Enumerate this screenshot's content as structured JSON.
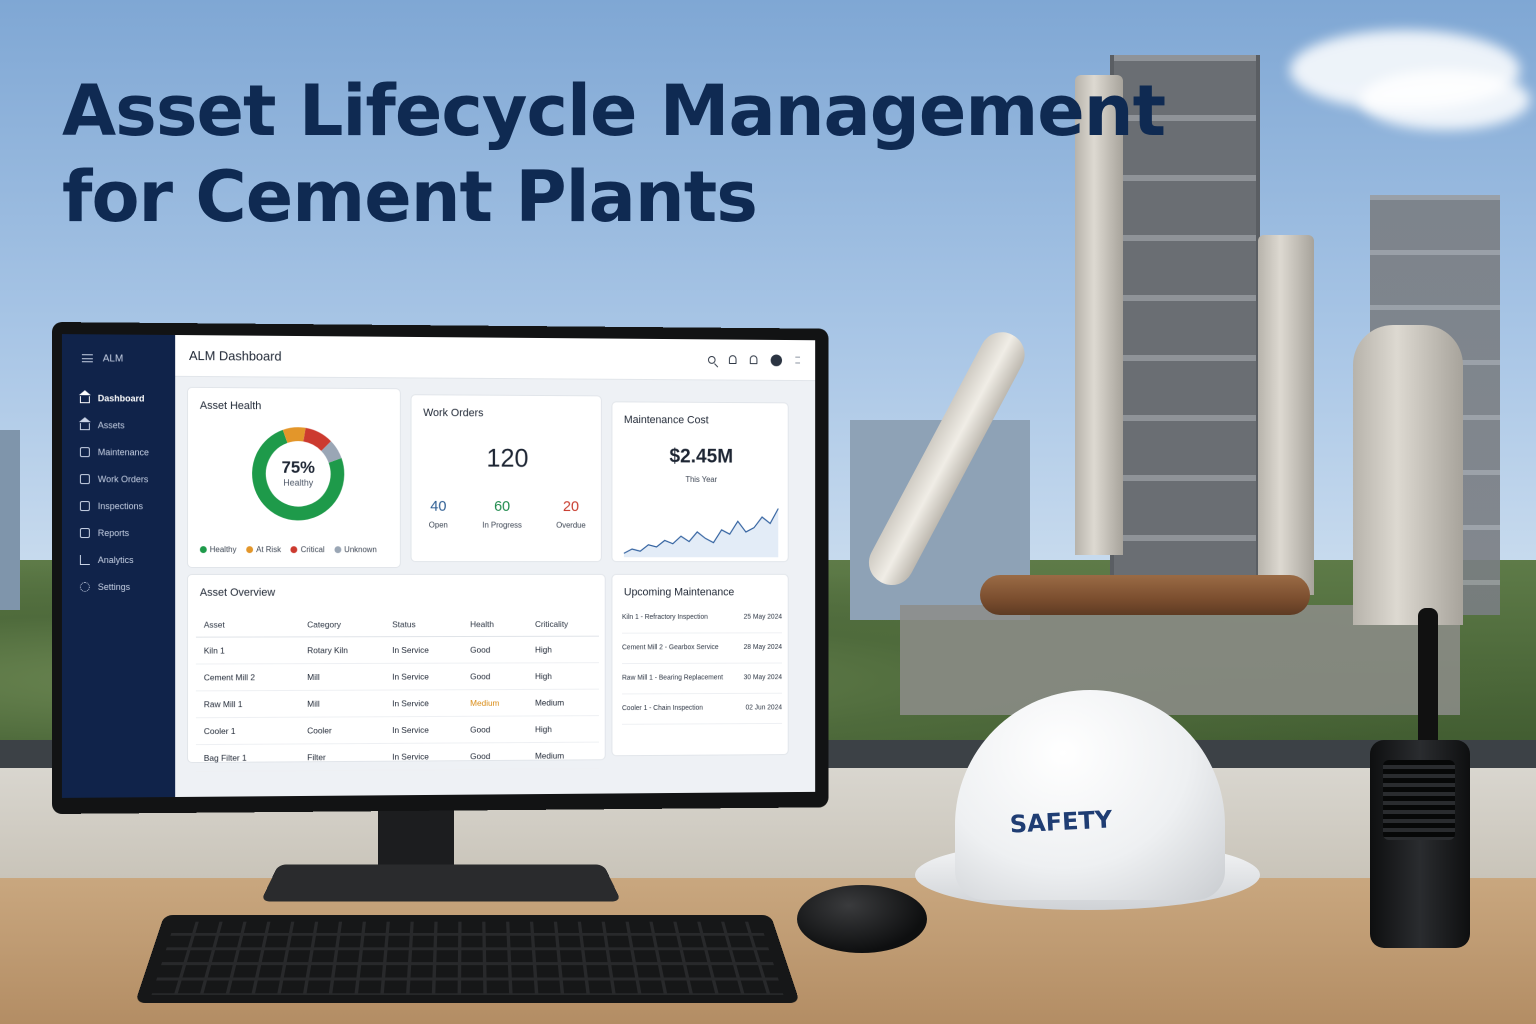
{
  "headline": {
    "line1": "Asset Lifecycle Management",
    "line2": "for Cement Plants"
  },
  "app": {
    "brand": "ALM",
    "title": "ALM Dashboard",
    "topbar_icons": [
      "search-icon",
      "bell-icon",
      "bell-icon",
      "user-avatar-icon",
      "more-icon"
    ]
  },
  "sidebar": {
    "items": [
      {
        "label": "Dashboard",
        "icon": "house-icon",
        "active": true
      },
      {
        "label": "Assets",
        "icon": "house-icon"
      },
      {
        "label": "Maintenance",
        "icon": "wrench-icon"
      },
      {
        "label": "Work Orders",
        "icon": "clipboard-icon"
      },
      {
        "label": "Inspections",
        "icon": "checklist-icon"
      },
      {
        "label": "Reports",
        "icon": "report-icon"
      },
      {
        "label": "Analytics",
        "icon": "chart-icon"
      },
      {
        "label": "Settings",
        "icon": "gear-icon"
      }
    ]
  },
  "asset_health": {
    "title": "Asset Health",
    "percent": "75%",
    "caption": "Healthy",
    "legend": [
      "Healthy",
      "At Risk",
      "Critical",
      "Unknown"
    ],
    "colors": {
      "healthy": "#1e9a4a",
      "at_risk": "#e3962a",
      "critical": "#cc3a2f",
      "unknown": "#9aa6b5"
    }
  },
  "work_orders": {
    "title": "Work Orders",
    "total": "120",
    "stats": [
      {
        "value": "40",
        "label": "Open",
        "color": "#2e5e93"
      },
      {
        "value": "60",
        "label": "In Progress",
        "color": "#1e8a4c"
      },
      {
        "value": "20",
        "label": "Overdue",
        "color": "#c83a2c"
      }
    ]
  },
  "maintenance_cost": {
    "title": "Maintenance Cost",
    "value": "$2.45M",
    "period": "This Year"
  },
  "asset_overview": {
    "title": "Asset Overview",
    "columns": [
      "Asset",
      "Category",
      "Status",
      "Health",
      "Criticality"
    ],
    "rows": [
      [
        "Kiln 1",
        "Rotary Kiln",
        "In Service",
        "Good",
        "High"
      ],
      [
        "Cement Mill 2",
        "Mill",
        "In Service",
        "Good",
        "High"
      ],
      [
        "Raw Mill 1",
        "Mill",
        "In Service",
        "Medium",
        "Medium"
      ],
      [
        "Cooler 1",
        "Cooler",
        "In Service",
        "Good",
        "High"
      ],
      [
        "Bag Filter 1",
        "Filter",
        "In Service",
        "Good",
        "Medium"
      ]
    ]
  },
  "upcoming_maintenance": {
    "title": "Upcoming Maintenance",
    "items": [
      {
        "task": "Kiln 1 - Refractory Inspection",
        "date": "25 May 2024"
      },
      {
        "task": "Cement Mill 2 - Gearbox Service",
        "date": "28 May 2024"
      },
      {
        "task": "Raw Mill 1 - Bearing Replacement",
        "date": "30 May 2024"
      },
      {
        "task": "Cooler 1 - Chain Inspection",
        "date": "02 Jun 2024"
      }
    ]
  },
  "helmet": {
    "label": "SAFETY"
  },
  "chart_data": [
    {
      "type": "pie",
      "labels": [
        "Healthy",
        "At Risk",
        "Critical",
        "Unknown"
      ],
      "values": [
        75,
        8,
        10,
        7
      ],
      "colors": [
        "#1e9a4a",
        "#e3962a",
        "#cc3a2f",
        "#9aa6b5"
      ]
    },
    {
      "type": "line",
      "x": [
        1,
        2,
        3,
        4,
        5,
        6,
        7,
        8,
        9,
        10,
        11,
        12,
        13,
        14,
        15,
        16,
        17,
        18,
        19,
        20
      ],
      "values": [
        10,
        14,
        12,
        18,
        16,
        22,
        19,
        26,
        21,
        30,
        24,
        20,
        32,
        28,
        40,
        30,
        34,
        44,
        38,
        52
      ],
      "color": "#2f5f9e"
    }
  ]
}
